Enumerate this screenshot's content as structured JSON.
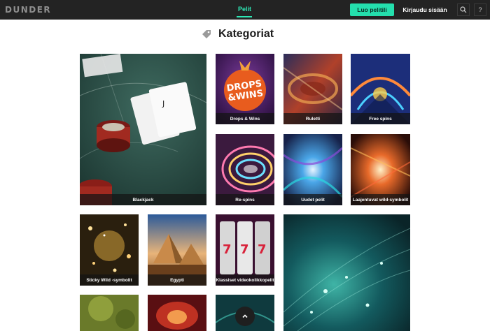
{
  "header": {
    "logo": "DUNDER",
    "nav_games": "Pelit",
    "signup_label": "Luo pelitili",
    "login_label": "Kirjaudu sisään",
    "search_icon": "search-icon",
    "help_label": "?"
  },
  "page": {
    "title": "Kategoriat",
    "title_icon": "tag-icon"
  },
  "categories": [
    {
      "label": "Blackjack"
    },
    {
      "label": "Drops & Wins",
      "art_text_1": "DROPS",
      "art_text_2": "&WINS"
    },
    {
      "label": "Ruletti"
    },
    {
      "label": "Free spins"
    },
    {
      "label": "Re-spins"
    },
    {
      "label": "Uudet pelit"
    },
    {
      "label": "Laajentuvat wild-symbolit"
    },
    {
      "label": "Sticky Wild -symbolit"
    },
    {
      "label": "Egypti"
    },
    {
      "label": "Klassiset videokolikkopelit"
    }
  ],
  "colors": {
    "accent": "#24dfad",
    "header_bg": "#232323"
  },
  "scroll_top_icon": "chevron-up-icon"
}
